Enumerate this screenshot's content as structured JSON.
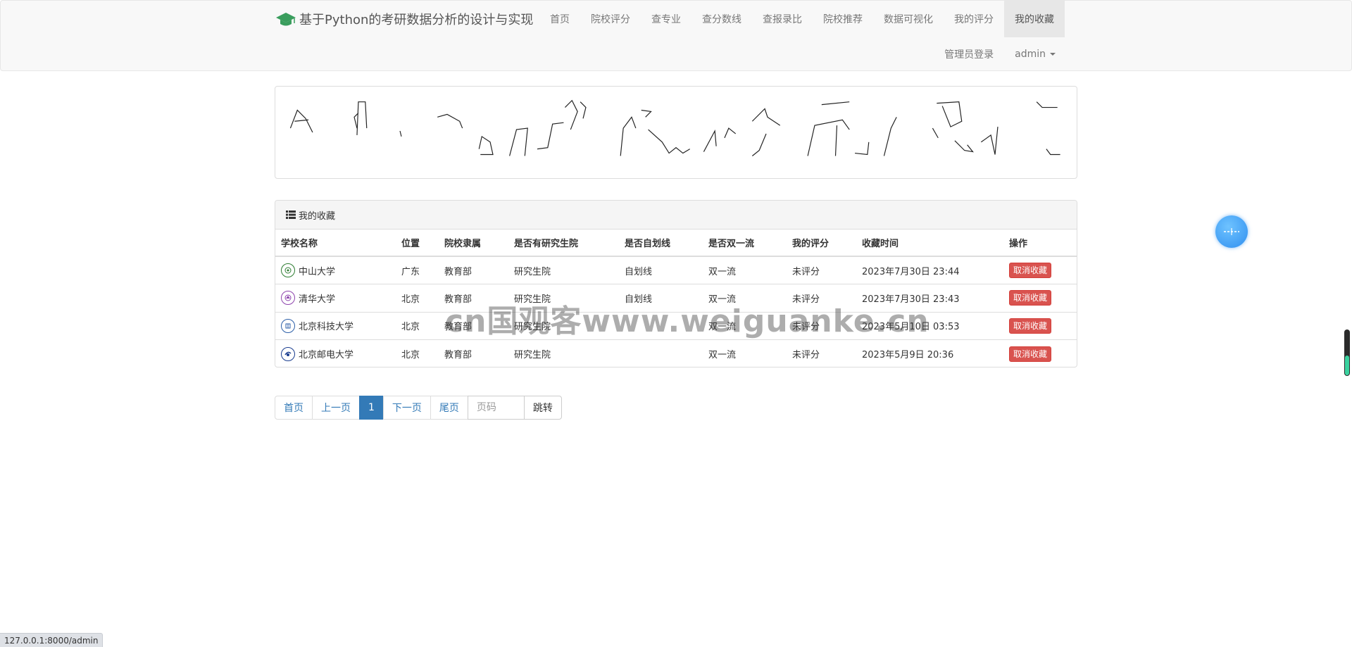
{
  "brand": {
    "title": "基于Python的考研数据分析的设计与实现",
    "icon": "graduation-cap-icon",
    "icon_color": "#3a9d5d"
  },
  "nav": {
    "items": [
      "首页",
      "院校评分",
      "查专业",
      "查分数线",
      "查报录比",
      "院校推荐",
      "数据可视化",
      "我的评分",
      "我的收藏"
    ],
    "active": "我的收藏",
    "admin_login": "管理员登录",
    "user": "admin"
  },
  "panel": {
    "title": "我的收藏",
    "columns": [
      "学校名称",
      "位置",
      "院校隶属",
      "是否有研究生院",
      "是否自划线",
      "是否双一流",
      "我的评分",
      "收藏时间",
      "操作"
    ],
    "rows": [
      {
        "name": "中山大学",
        "location": "广东",
        "affiliation": "教育部",
        "grad_school": "研究生院",
        "self_line": "自划线",
        "double_first": "双一流",
        "rating": "未评分",
        "time": "2023年7月30日 23:44",
        "action": "取消收藏",
        "logo_color": "#2e7d32"
      },
      {
        "name": "清华大学",
        "location": "北京",
        "affiliation": "教育部",
        "grad_school": "研究生院",
        "self_line": "自划线",
        "double_first": "双一流",
        "rating": "未评分",
        "time": "2023年7月30日 23:43",
        "action": "取消收藏",
        "logo_color": "#8e44ad"
      },
      {
        "name": "北京科技大学",
        "location": "北京",
        "affiliation": "教育部",
        "grad_school": "研究生院",
        "self_line": "",
        "double_first": "双一流",
        "rating": "未评分",
        "time": "2023年5月10日 03:53",
        "action": "取消收藏",
        "logo_color": "#2c5fa8"
      },
      {
        "name": "北京邮电大学",
        "location": "北京",
        "affiliation": "教育部",
        "grad_school": "研究生院",
        "self_line": "",
        "double_first": "双一流",
        "rating": "未评分",
        "time": "2023年5月9日 20:36",
        "action": "取消收藏",
        "logo_color": "#1a3d8f"
      }
    ]
  },
  "pagination": {
    "first": "首页",
    "prev": "上一页",
    "current": "1",
    "next": "下一页",
    "last": "尾页",
    "input_placeholder": "页码",
    "jump": "跳转"
  },
  "watermark": "cn国观客www.weiguanke.cn",
  "status_url": "127.0.0.1:8000/admin",
  "colors": {
    "primary": "#337ab7",
    "danger": "#d9534f",
    "navbar_bg": "#f8f8f8"
  }
}
